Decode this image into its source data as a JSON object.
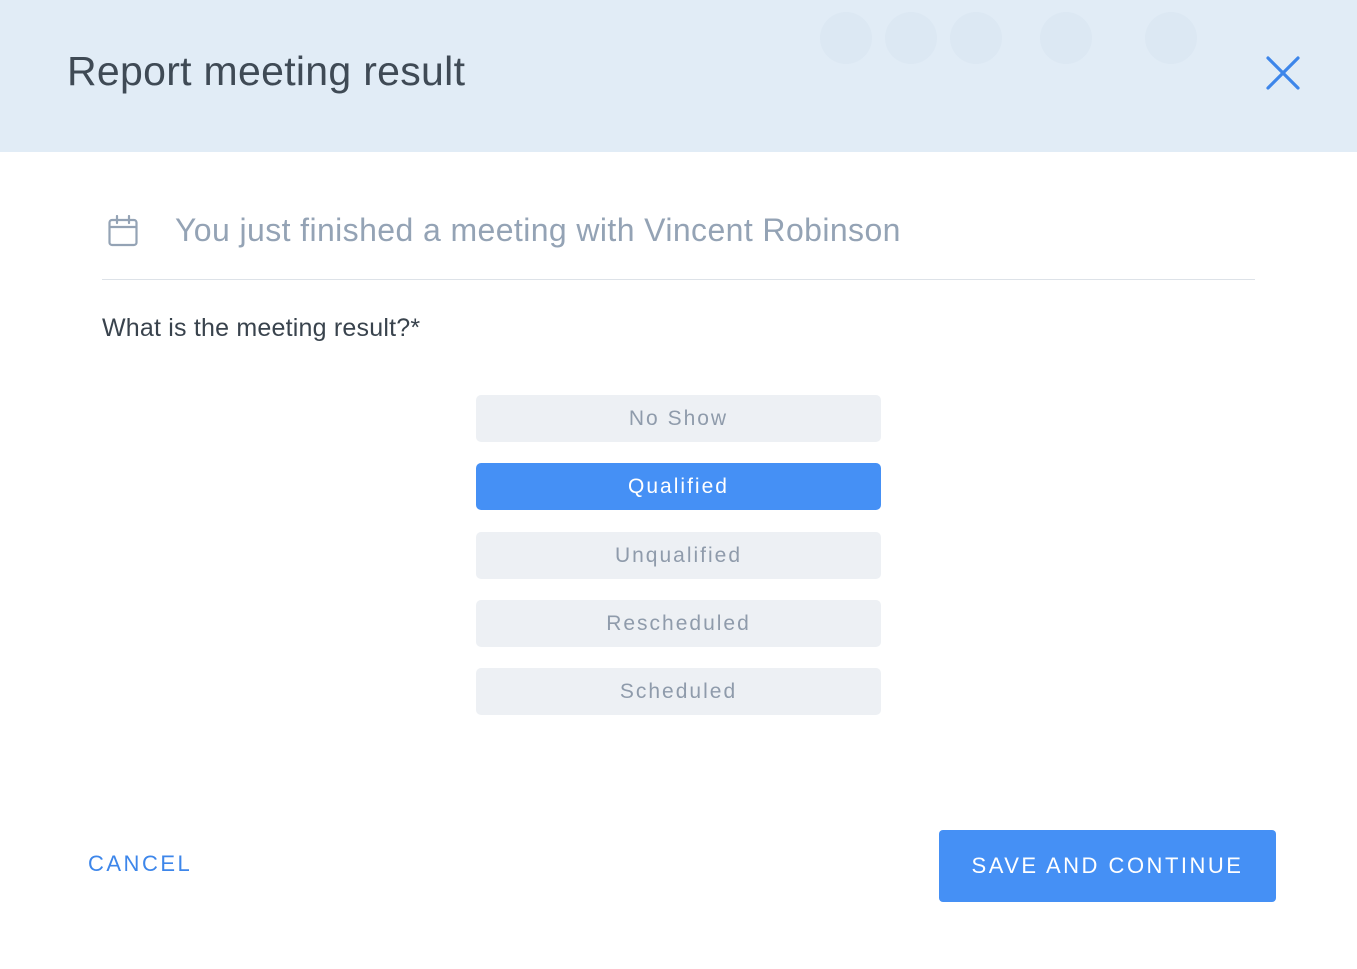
{
  "modal": {
    "title": "Report meeting result",
    "close_icon": "close-icon"
  },
  "info": {
    "icon": "calendar-icon",
    "text": "You just finished a meeting with Vincent Robinson"
  },
  "question": {
    "label": "What is the meeting result?*"
  },
  "options": [
    {
      "label": "No Show",
      "selected": false
    },
    {
      "label": "Qualified",
      "selected": true
    },
    {
      "label": "Unqualified",
      "selected": false
    },
    {
      "label": "Rescheduled",
      "selected": false
    },
    {
      "label": "Scheduled",
      "selected": false
    }
  ],
  "footer": {
    "cancel_label": "CANCEL",
    "save_label": "SAVE AND CONTINUE"
  },
  "colors": {
    "accent": "#4590f5",
    "header_bg": "#e1ecf6",
    "option_bg": "#edf0f4"
  }
}
